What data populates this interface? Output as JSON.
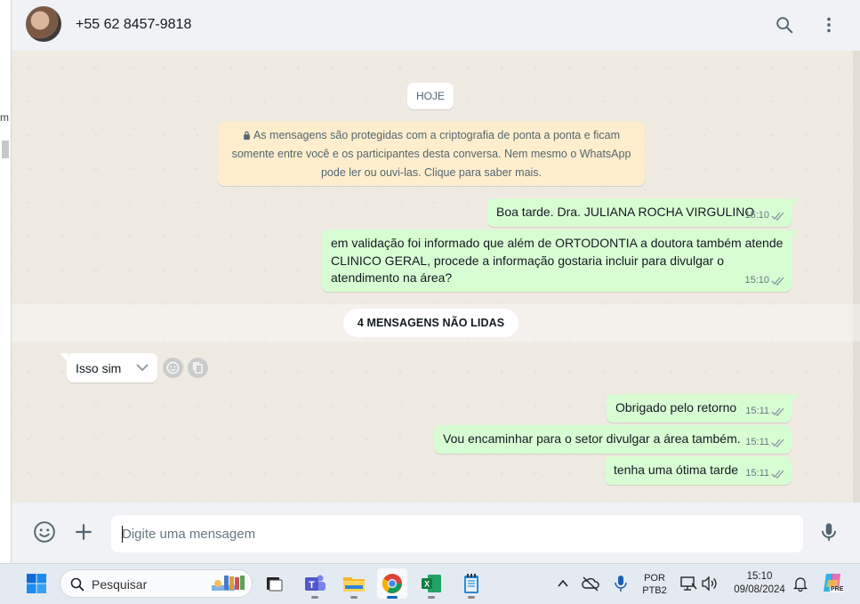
{
  "header": {
    "contact": "+55 62 8457-9818",
    "icons": [
      "search-icon",
      "more-vertical-icon"
    ]
  },
  "left_panel": {
    "fragment": "m"
  },
  "chat": {
    "day_label": "HOJE",
    "encryption_lines": [
      "As mensagens são protegidas com a criptografia de ponta a ponta e ficam",
      "somente entre você e os participantes desta conversa. Nem mesmo o WhatsApp",
      "pode ler ou ouvi-las. Clique para saber mais."
    ],
    "sent_1": {
      "text": "Boa tarde. Dra. JULIANA ROCHA VIRGULINO",
      "time": "15:10"
    },
    "sent_2": {
      "lines": [
        "em validação foi informado que além de ORTODONTIA a doutora também atende",
        "CLINICO GERAL, procede a informação gostaria incluir para divulgar o",
        "atendimento na área?"
      ],
      "time": "15:10"
    },
    "unread_label": "4 MENSAGENS NÃO LIDAS",
    "received_1": {
      "text": "Isso sim"
    },
    "sent_3": {
      "text": "Obrigado pelo retorno",
      "time": "15:11"
    },
    "sent_4": {
      "text": "Vou encaminhar para o setor divulgar a área também.",
      "time": "15:11"
    },
    "sent_5": {
      "text": "tenha uma ótima tarde",
      "time": "15:11"
    }
  },
  "composer": {
    "placeholder": "Digite uma mensagem"
  },
  "taskbar": {
    "search_label": "Pesquisar",
    "language": "POR",
    "layout": "PTB2",
    "time": "15:10",
    "date": "09/08/2024",
    "copilot_badge": "PRE"
  },
  "colors": {
    "outgoing": "#d9fdd3",
    "incoming": "#ffffff",
    "system": "#ffeecd",
    "background": "#efeae2",
    "header": "#f0f2f5"
  }
}
